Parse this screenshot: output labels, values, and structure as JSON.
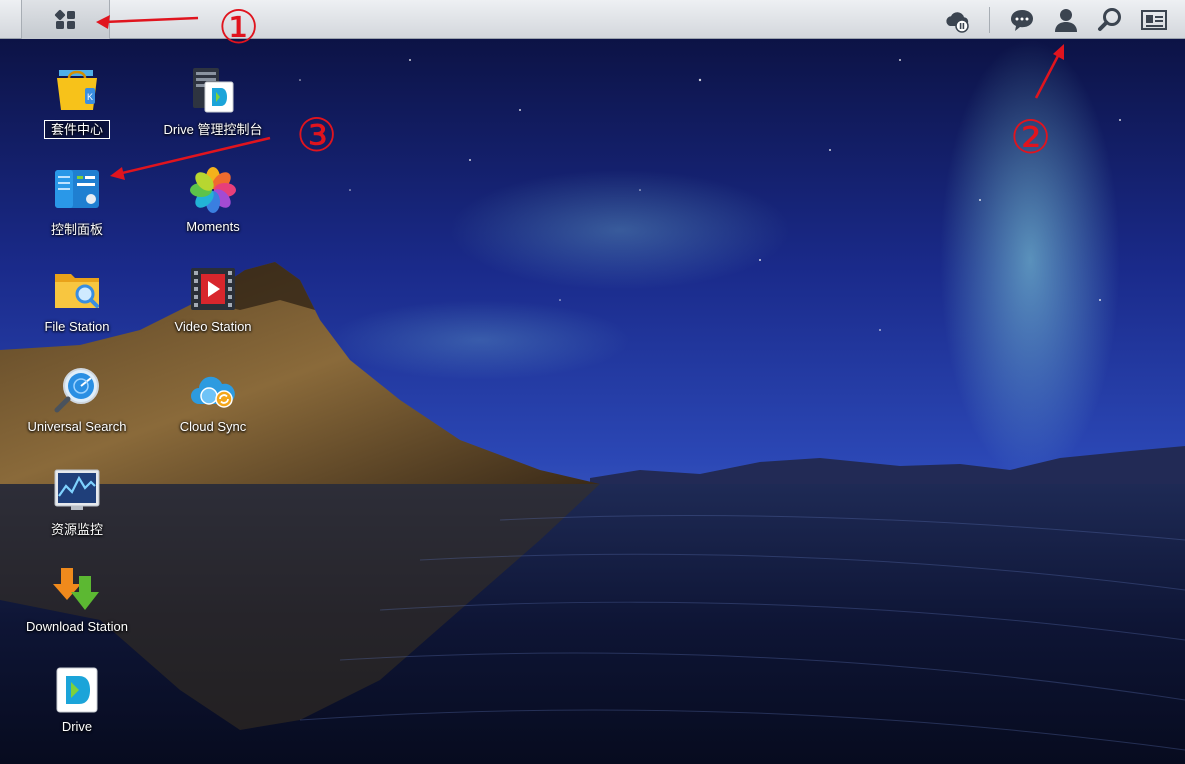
{
  "taskbar": {
    "main_menu_icon": "apps-grid-icon",
    "right_icons": [
      "cloud-sync-status-icon",
      "notifications-chat-icon",
      "user-icon",
      "search-icon",
      "widgets-icon"
    ]
  },
  "desktop": {
    "icons": [
      {
        "label": "套件中心",
        "icon": "package-center-icon"
      },
      {
        "label": "Drive 管理控制台",
        "icon": "drive-admin-console-icon"
      },
      {
        "label": "控制面板",
        "icon": "control-panel-icon"
      },
      {
        "label": "Moments",
        "icon": "moments-icon"
      },
      {
        "label": "File Station",
        "icon": "file-station-icon"
      },
      {
        "label": "Video Station",
        "icon": "video-station-icon"
      },
      {
        "label": "Universal Search",
        "icon": "universal-search-icon"
      },
      {
        "label": "Cloud Sync",
        "icon": "cloud-sync-icon"
      },
      {
        "label": "资源监控",
        "icon": "resource-monitor-icon"
      },
      {
        "label": "Download Station",
        "icon": "download-station-icon"
      },
      {
        "label": "Drive",
        "icon": "drive-icon"
      }
    ]
  },
  "annotations": {
    "labels": [
      "①",
      "②",
      "③"
    ],
    "color": "#e0141e"
  }
}
